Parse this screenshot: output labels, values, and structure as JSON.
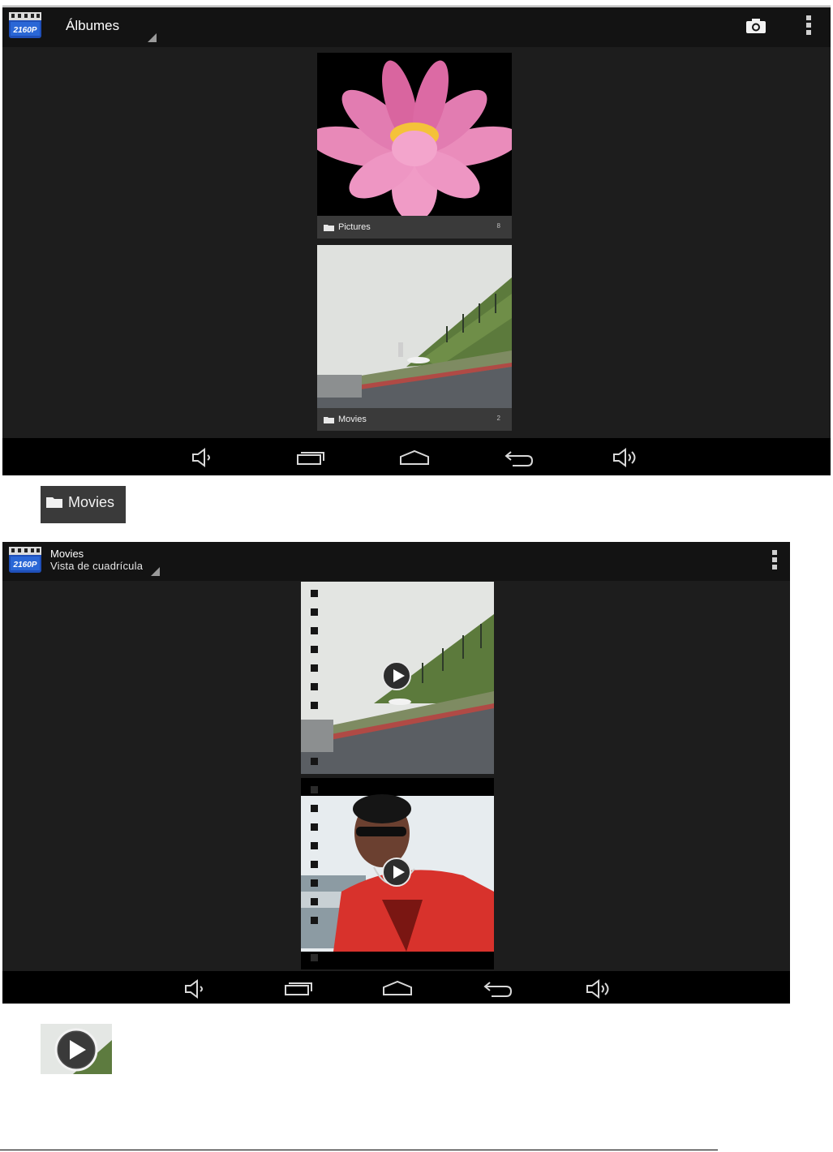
{
  "screen1": {
    "app_badge": "2160P",
    "title": "Álbumes",
    "albums": [
      {
        "name": "Pictures",
        "count": "8"
      },
      {
        "name": "Movies",
        "count": "2"
      }
    ]
  },
  "crop1": {
    "label": "Movies"
  },
  "screen2": {
    "app_badge": "2160P",
    "title": "Movies",
    "subtitle": "Vista de cuadrícula"
  },
  "icons": [
    "camera-icon",
    "overflow-menu-icon",
    "folder-icon",
    "volume-down-icon",
    "recent-apps-icon",
    "home-icon",
    "back-icon",
    "volume-up-icon",
    "play-icon"
  ],
  "colors": {
    "actionbar": "#131313",
    "content": "#1d1d1d",
    "navbar": "#000000",
    "album_label": "#3a3a3a"
  }
}
